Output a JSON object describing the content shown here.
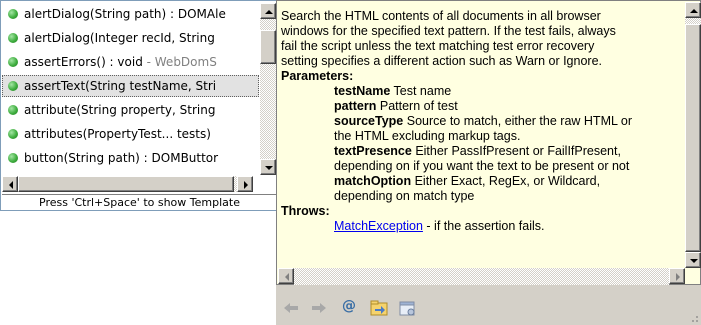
{
  "proposals": {
    "items": [
      {
        "signature": "alertDialog(String path) : DOMAle",
        "type": ""
      },
      {
        "signature": "alertDialog(Integer recId, String ",
        "type": ""
      },
      {
        "signature": "assertErrors() : void",
        "type": " - WebDomS"
      },
      {
        "signature": "assertText(String testName, Stri",
        "type": ""
      },
      {
        "signature": "attribute(String property, String",
        "type": ""
      },
      {
        "signature": "attributes(PropertyTest... tests)",
        "type": ""
      },
      {
        "signature": "button(String path) : DOMButtor",
        "type": ""
      }
    ],
    "selected_index": 3,
    "status_text": "Press 'Ctrl+Space' to show Template",
    "list_scroll_position": 0.1,
    "horizontal_scroll_position": 0.0
  },
  "doc": {
    "description_lines": [
      "Search the HTML contents of all documents in all browser",
      "windows for the specified text pattern. If the test fails, always",
      "fail the script unless the text matching test error recovery",
      "setting specifies a different action such as Warn or Ignore."
    ],
    "parameters_heading": "Parameters:",
    "parameters": [
      {
        "name": "testName",
        "desc": "Test name"
      },
      {
        "name": "pattern",
        "desc": "Pattern of test"
      },
      {
        "name": "sourceType",
        "desc": "Source to match, either the raw HTML or"
      },
      {
        "name": "",
        "desc": "the HTML excluding markup tags."
      },
      {
        "name": "textPresence",
        "desc": "Either PassIfPresent or FailIfPresent,"
      },
      {
        "name": "",
        "desc": "depending on if you want the text to be present or not"
      },
      {
        "name": "matchOption",
        "desc": "Either Exact, RegEx, or Wildcard,"
      },
      {
        "name": "",
        "desc": "depending on match type"
      }
    ],
    "throws_heading": "Throws:",
    "throws": {
      "exception": "MatchException",
      "desc": " - if the assertion fails."
    },
    "vertical_scroll_position": 1.0
  },
  "toolbar": {
    "buttons": [
      "back-icon",
      "forward-icon",
      "at-sign-icon",
      "open-declaration-icon",
      "open-browser-icon"
    ],
    "at_sign": "@"
  },
  "colors": {
    "doc_background": "#ffffe1",
    "selection": "#e2e2e2",
    "link": "#0000ee",
    "chrome": "#d4d0c8"
  }
}
